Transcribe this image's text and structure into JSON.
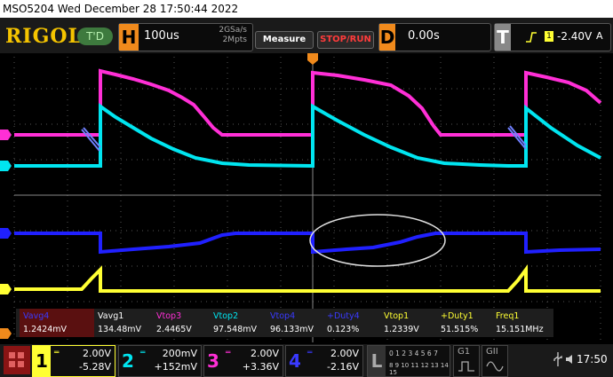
{
  "title_bar": "MSO5204  Wed December 28 17:50:44 2022",
  "logo": "RIGOL",
  "trigger_status": "T'D",
  "horizontal": {
    "letter": "H",
    "timebase": "100us",
    "sample_rate": "2GSa/s",
    "memory_depth": "2Mpts"
  },
  "buttons": {
    "measure": "Measure",
    "stop_run": "STOP/RUN"
  },
  "delay": {
    "letter": "D",
    "value": "0.00s"
  },
  "trigger": {
    "letter": "T",
    "channel": "1",
    "level": "-2.40V",
    "mode": "A"
  },
  "measurements": [
    {
      "label": "Vavg4",
      "value": "1.2424mV",
      "color": "#3a3aff"
    },
    {
      "label": "Vavg1",
      "value": "134.48mV",
      "color": "#ffffff"
    },
    {
      "label": "Vtop3",
      "value": "2.4465V",
      "color": "#ff2fd6"
    },
    {
      "label": "Vtop2",
      "value": "97.548mV",
      "color": "#00e5f0"
    },
    {
      "label": "Vtop4",
      "value": "96.133mV",
      "color": "#3a3aff"
    },
    {
      "label": "+Duty4",
      "value": "0.123%",
      "color": "#3a3aff"
    },
    {
      "label": "Vtop1",
      "value": "1.2339V",
      "color": "#ffff33"
    },
    {
      "label": "+Duty1",
      "value": "51.515%",
      "color": "#ffff33"
    },
    {
      "label": "Freq1",
      "value": "15.151MHz",
      "color": "#ffff33"
    }
  ],
  "channels": [
    {
      "num": "1",
      "scale": "2.00V",
      "offset": "-5.28V",
      "color": "#ffff33"
    },
    {
      "num": "2",
      "scale": "200mV",
      "offset": "+152mV",
      "color": "#00e5f0"
    },
    {
      "num": "3",
      "scale": "2.00V",
      "offset": "+3.36V",
      "color": "#ff2fd6"
    },
    {
      "num": "4",
      "scale": "2.00V",
      "offset": "-2.16V",
      "color": "#3a3aff"
    }
  ],
  "digital": {
    "letter": "L",
    "row1": "0 1 2 3  4 5 6 7",
    "row2": "8 9 10 11 12 13 14 15"
  },
  "generators": {
    "g1": "G1",
    "g2": "GII"
  },
  "clock": "17:50",
  "colors": {
    "ch1": "#ffff33",
    "ch2": "#00e5f0",
    "ch3": "#ff2fd6",
    "ch4": "#2020ff",
    "accent": "#f08a1c"
  }
}
